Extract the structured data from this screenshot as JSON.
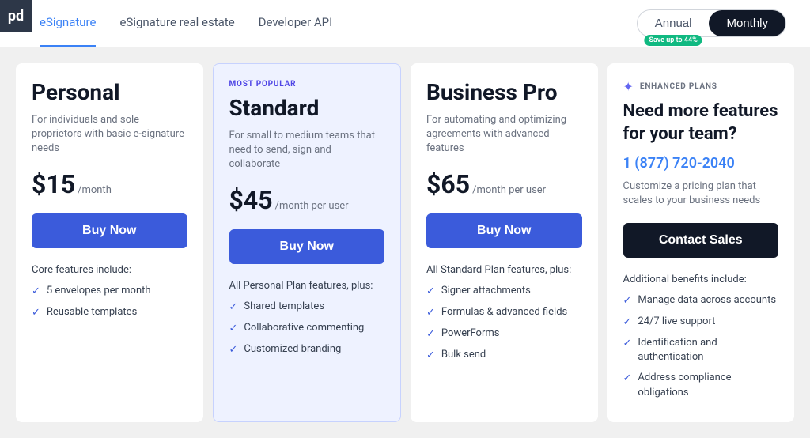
{
  "logo": {
    "icon": "pd"
  },
  "nav": {
    "tabs": [
      {
        "label": "eSignature",
        "active": true
      },
      {
        "label": "eSignature real estate",
        "active": false
      },
      {
        "label": "Developer API",
        "active": false
      }
    ],
    "toggle": {
      "annual_label": "Annual",
      "monthly_label": "Monthly",
      "save_badge": "Save up to 44%",
      "active": "monthly"
    }
  },
  "plans": [
    {
      "id": "personal",
      "name": "Personal",
      "description": "For individuals and sole proprietors with basic e-signature needs",
      "price": "$15",
      "period": "/month",
      "button_label": "Buy Now",
      "features_label": "Core features include:",
      "features": [
        "5 envelopes per month",
        "Reusable templates"
      ],
      "most_popular": false
    },
    {
      "id": "standard",
      "name": "Standard",
      "description": "For small to medium teams that need to send, sign and collaborate",
      "price": "$45",
      "period": "/month per user",
      "button_label": "Buy Now",
      "features_label": "All Personal Plan features, plus:",
      "features": [
        "Shared templates",
        "Collaborative commenting",
        "Customized branding"
      ],
      "most_popular": true,
      "most_popular_label": "MOST POPULAR"
    },
    {
      "id": "business_pro",
      "name": "Business Pro",
      "description": "For automating and optimizing agreements with advanced features",
      "price": "$65",
      "period": "/month per user",
      "button_label": "Buy Now",
      "features_label": "All Standard Plan features, plus:",
      "features": [
        "Signer attachments",
        "Formulas & advanced fields",
        "PowerForms",
        "Bulk send"
      ],
      "most_popular": false
    }
  ],
  "enhanced": {
    "label": "ENHANCED PLANS",
    "title": "Need more features for your team?",
    "phone": "1 (877) 720-2040",
    "description": "Customize a pricing plan that scales to your business needs",
    "button_label": "Contact Sales",
    "features_label": "Additional benefits include:",
    "features": [
      "Manage data across accounts",
      "24/7 live support",
      "Identification and authentication",
      "Address compliance obligations"
    ]
  }
}
